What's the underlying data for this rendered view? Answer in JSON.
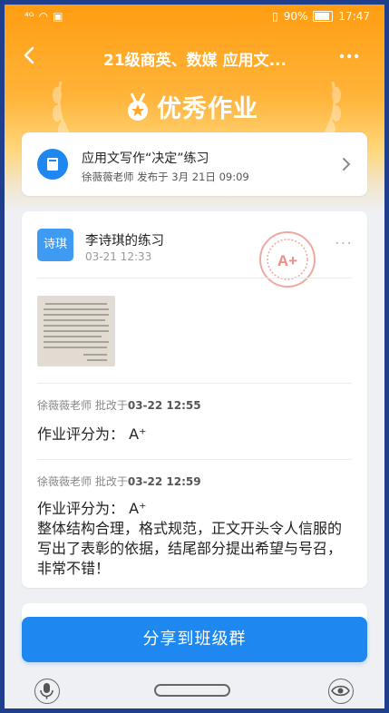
{
  "status_bar": {
    "signal": "⁴ᴳ",
    "battery_percent": "90%",
    "time": "17:47"
  },
  "nav": {
    "title": "21级商英、数媒 应用文..."
  },
  "logo": {
    "text": "优秀作业"
  },
  "task": {
    "title": "应用文写作“决定”练习",
    "meta": "徐薇薇老师 发布于 3月 21日 09:09"
  },
  "submission": {
    "avatar_text": "诗琪",
    "student_name": "李诗琪的练习",
    "time": "03-21 12:33",
    "stamp_text": "A+",
    "more": "···"
  },
  "comments": [
    {
      "teacher": "徐薇薇老师",
      "action": " 批改于",
      "time": "03-22 12:55",
      "text": "作业评分为： A⁺"
    },
    {
      "teacher": "徐薇薇老师",
      "action": " 批改于",
      "time": "03-22 12:59",
      "text": "作业评分为： A⁺\n整体结构合理，格式规范，正文开头令人信服的写出了表彰的依据，结尾部分提出希望与号召，非常不错！"
    }
  ],
  "share_button": {
    "label": "分享到班级群"
  },
  "colors": {
    "accent": "#1e88f0",
    "header": "#ffa726"
  },
  "icons": [
    "back-arrow-icon",
    "more-icon",
    "medal-icon",
    "book-icon",
    "chevron-right-icon",
    "mic-icon",
    "eye-icon"
  ]
}
